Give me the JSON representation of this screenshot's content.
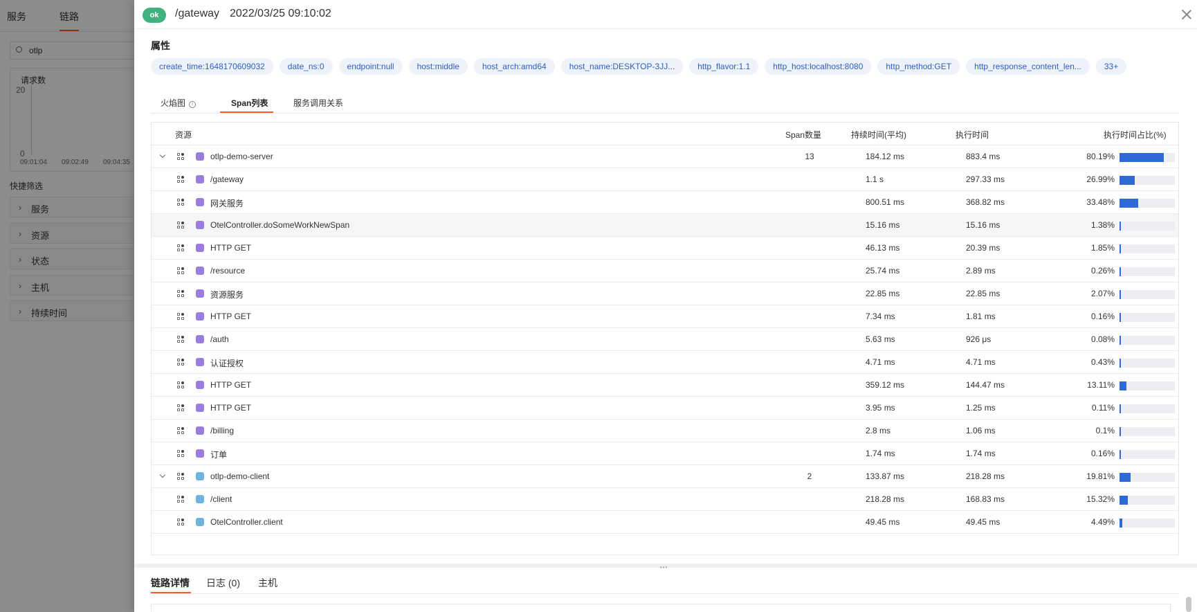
{
  "background": {
    "tabs": [
      "服务",
      "链路"
    ],
    "search_value": "otlp",
    "chart": {
      "title": "请求数",
      "y_ticks": [
        "20",
        "0"
      ],
      "x_ticks": [
        "09:01:04",
        "09:02:49",
        "09:04:35"
      ]
    },
    "quick_filter_title": "快捷筛选",
    "filters": [
      "服务",
      "资源",
      "状态",
      "主机",
      "持续时间"
    ]
  },
  "header": {
    "status": "ok",
    "status_color": "#3fb27f",
    "title": "/gateway",
    "timestamp": "2022/03/25 09:10:02"
  },
  "attributes": {
    "title": "属性",
    "tags": [
      "create_time:1648170609032",
      "date_ns:0",
      "endpoint:null",
      "host:middle",
      "host_arch:amd64",
      "host_name:DESKTOP-3JJ...",
      "http_flavor:1.1",
      "http_host:localhost:8080",
      "http_method:GET",
      "http_response_content_len...",
      "33+"
    ]
  },
  "tabs": {
    "flame": "火焰图",
    "span_list": "Span列表",
    "service_map": "服务调用关系",
    "active": "span_list"
  },
  "table": {
    "headers": {
      "resource": "资源",
      "span_count": "Span数量",
      "duration_avg": "持续时间(平均)",
      "exec_time": "执行时间",
      "exec_pct": "执行时间占比(%)"
    },
    "rows": [
      {
        "name": "otlp-demo-server",
        "group": true,
        "color": "#9b7de0",
        "count": "13",
        "duration": "184.12 ms",
        "exec": "883.4 ms",
        "pct": "80.19%",
        "pct_value": 80.19
      },
      {
        "name": "/gateway",
        "color": "#9b7de0",
        "count": "",
        "duration": "1.1 s",
        "exec": "297.33 ms",
        "pct": "26.99%",
        "pct_value": 26.99
      },
      {
        "name": "网关服务",
        "color": "#9b7de0",
        "count": "",
        "duration": "800.51 ms",
        "exec": "368.82 ms",
        "pct": "33.48%",
        "pct_value": 33.48
      },
      {
        "name": "OtelController.doSomeWorkNewSpan",
        "color": "#9b7de0",
        "count": "",
        "duration": "15.16 ms",
        "exec": "15.16 ms",
        "pct": "1.38%",
        "pct_value": 1.38,
        "hover": true
      },
      {
        "name": "HTTP GET",
        "color": "#9b7de0",
        "count": "",
        "duration": "46.13 ms",
        "exec": "20.39 ms",
        "pct": "1.85%",
        "pct_value": 1.85
      },
      {
        "name": "/resource",
        "color": "#9b7de0",
        "count": "",
        "duration": "25.74 ms",
        "exec": "2.89 ms",
        "pct": "0.26%",
        "pct_value": 0.26
      },
      {
        "name": "资源服务",
        "color": "#9b7de0",
        "count": "",
        "duration": "22.85 ms",
        "exec": "22.85 ms",
        "pct": "2.07%",
        "pct_value": 2.07
      },
      {
        "name": "HTTP GET",
        "color": "#9b7de0",
        "count": "",
        "duration": "7.34 ms",
        "exec": "1.81 ms",
        "pct": "0.16%",
        "pct_value": 0.16
      },
      {
        "name": "/auth",
        "color": "#9b7de0",
        "count": "",
        "duration": "5.63 ms",
        "exec": "926 μs",
        "pct": "0.08%",
        "pct_value": 0.08
      },
      {
        "name": "认证授权",
        "color": "#9b7de0",
        "count": "",
        "duration": "4.71 ms",
        "exec": "4.71 ms",
        "pct": "0.43%",
        "pct_value": 0.43
      },
      {
        "name": "HTTP GET",
        "color": "#9b7de0",
        "count": "",
        "duration": "359.12 ms",
        "exec": "144.47 ms",
        "pct": "13.11%",
        "pct_value": 13.11
      },
      {
        "name": "HTTP GET",
        "color": "#9b7de0",
        "count": "",
        "duration": "3.95 ms",
        "exec": "1.25 ms",
        "pct": "0.11%",
        "pct_value": 0.11
      },
      {
        "name": "/billing",
        "color": "#9b7de0",
        "count": "",
        "duration": "2.8 ms",
        "exec": "1.06 ms",
        "pct": "0.1%",
        "pct_value": 0.1
      },
      {
        "name": "订单",
        "color": "#9b7de0",
        "count": "",
        "duration": "1.74 ms",
        "exec": "1.74 ms",
        "pct": "0.16%",
        "pct_value": 0.16
      },
      {
        "name": "otlp-demo-client",
        "group": true,
        "color": "#6fb3e0",
        "count": "2",
        "duration": "133.87 ms",
        "exec": "218.28 ms",
        "pct": "19.81%",
        "pct_value": 19.81
      },
      {
        "name": "/client",
        "color": "#6fb3e0",
        "count": "",
        "duration": "218.28 ms",
        "exec": "168.83 ms",
        "pct": "15.32%",
        "pct_value": 15.32
      },
      {
        "name": "OtelController.client",
        "color": "#6fb3e0",
        "count": "",
        "duration": "49.45 ms",
        "exec": "49.45 ms",
        "pct": "4.49%",
        "pct_value": 4.49
      }
    ]
  },
  "bottom_tabs": {
    "detail": "链路详情",
    "logs": "日志 (0)",
    "host": "主机"
  },
  "colors": {
    "accent": "#ff5a1f",
    "bar": "#2d6ad6",
    "tag_text": "#2d5ec4"
  }
}
